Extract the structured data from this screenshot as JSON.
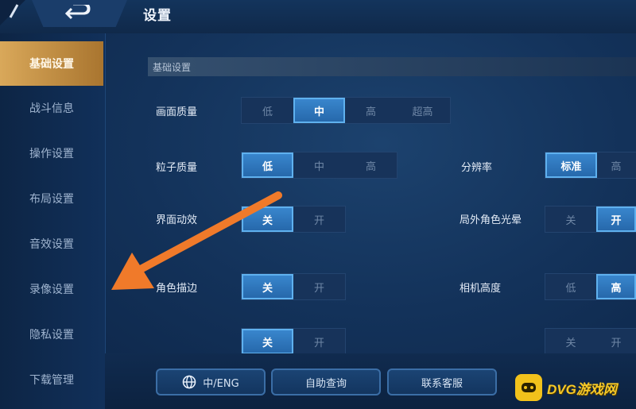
{
  "header": {
    "title": "设置"
  },
  "sidebar": {
    "items": [
      {
        "label": "基础设置",
        "active": true
      },
      {
        "label": "战斗信息",
        "active": false
      },
      {
        "label": "操作设置",
        "active": false
      },
      {
        "label": "布局设置",
        "active": false
      },
      {
        "label": "音效设置",
        "active": false
      },
      {
        "label": "录像设置",
        "active": false
      },
      {
        "label": "隐私设置",
        "active": false
      },
      {
        "label": "下载管理",
        "active": false
      }
    ]
  },
  "main": {
    "section_title": "基础设置",
    "settings": [
      {
        "label": "画面质量",
        "options": [
          "低",
          "中",
          "高",
          "超高"
        ],
        "selected": "中"
      },
      {
        "label": "粒子质量",
        "options": [
          "低",
          "中",
          "高"
        ],
        "selected": "低"
      },
      {
        "label": "分辨率",
        "options": [
          "标准",
          "高"
        ],
        "selected": "标准"
      },
      {
        "label": "界面动效",
        "options": [
          "关",
          "开"
        ],
        "selected": "关"
      },
      {
        "label": "局外角色光晕",
        "options": [
          "关",
          "开"
        ],
        "selected": "开"
      },
      {
        "label": "角色描边",
        "options": [
          "关",
          "开"
        ],
        "selected": "关"
      },
      {
        "label": "相机高度",
        "options": [
          "低",
          "高"
        ],
        "selected": "高"
      },
      {
        "label": "",
        "options": [
          "关",
          "开"
        ],
        "selected": "关"
      },
      {
        "label": "",
        "options": [
          "关",
          "开"
        ],
        "selected": "关"
      }
    ]
  },
  "footer": {
    "language_label": "中/ENG",
    "self_help_label": "自助查询",
    "contact_label": "联系客服"
  },
  "watermark": {
    "text": "DVG游戏网"
  },
  "colors": {
    "accent_active_tab": "#c8964a",
    "selected_option": "#2f78bf",
    "arrow": "#f07a2a",
    "watermark": "#f2c21b"
  }
}
